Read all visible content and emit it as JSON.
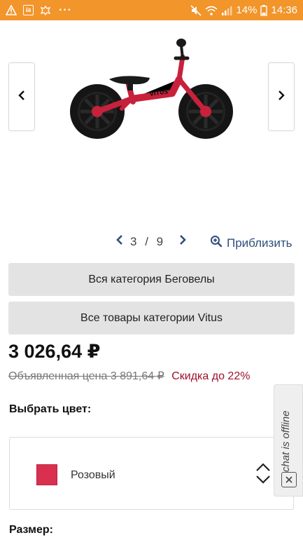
{
  "status_bar": {
    "app_icon_text": "la",
    "dots": "···",
    "battery_percent": "14%",
    "time": "14:36"
  },
  "gallery": {
    "current": "3",
    "separator": "/",
    "total": "9",
    "zoom_label": "Приблизить",
    "bike_brand": "VITUS"
  },
  "buttons": {
    "category_all": "Вся категория Беговелы",
    "category_brand": "Все товары категории Vitus"
  },
  "pricing": {
    "price": "3 026,64 ₽",
    "old_price": "Объявленная цена 3 891,64 ₽",
    "discount": "Скидка до 22%"
  },
  "options": {
    "color_label": "Выбрать цвет:",
    "color_value": "Розовый",
    "color_hex": "#d9304f",
    "size_label": "Размер:"
  },
  "chat": {
    "status": "chat is offline"
  },
  "colors": {
    "status_bar": "#f2952a",
    "link": "#2e4e7d",
    "discount": "#a0102a",
    "button_bg": "#e3e3e3"
  }
}
